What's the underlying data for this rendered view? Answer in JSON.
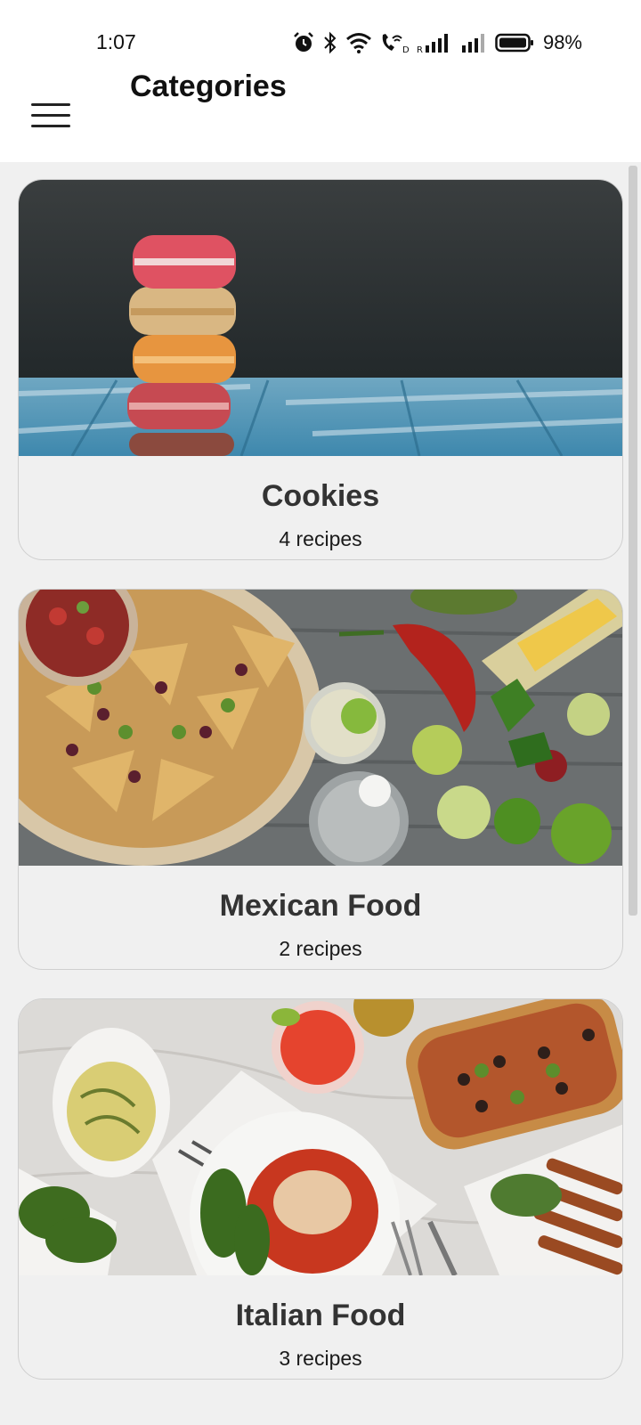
{
  "status_bar": {
    "time": "1:07",
    "battery_percent": "98%",
    "icons": [
      "alarm-icon",
      "bluetooth-icon",
      "wifi-icon",
      "wifi-call-icon",
      "signal-icon",
      "signal-icon-2",
      "battery-icon"
    ]
  },
  "app_bar": {
    "title": "Categories",
    "menu_icon": "hamburger-menu-icon"
  },
  "categories": [
    {
      "title": "Cookies",
      "subtitle": "4 recipes",
      "image": "macarons-stack-photo"
    },
    {
      "title": "Mexican Food",
      "subtitle": "2 recipes",
      "image": "nachos-and-vegetables-photo"
    },
    {
      "title": "Italian Food",
      "subtitle": "3 recipes",
      "image": "italian-dishes-table-photo"
    }
  ],
  "colors": {
    "background": "#f0f0f0",
    "card_border": "#cfcfcf",
    "title_text": "#333333"
  }
}
